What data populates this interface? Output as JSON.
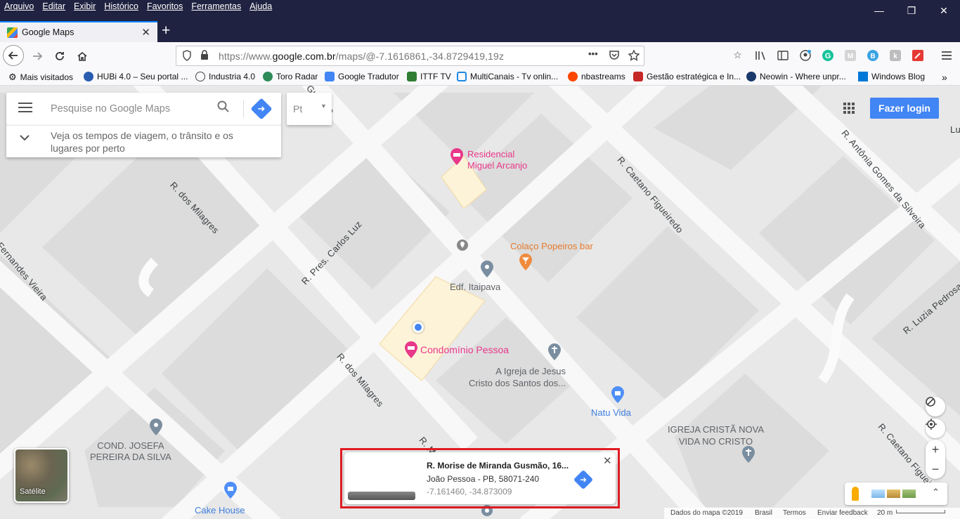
{
  "menubar": {
    "items": [
      "Arquivo",
      "Editar",
      "Exibir",
      "Histórico",
      "Favoritos",
      "Ferramentas",
      "Ajuda"
    ],
    "minimize": "—",
    "restore": "❐",
    "close": "✕"
  },
  "tab": {
    "title": "Google Maps",
    "close": "✕",
    "new_tab": "+"
  },
  "nav": {
    "url_prefix": "https://www.",
    "url_domain": "google.com.br",
    "url_rest": "/maps/@-7.1616861,-34.8729419,19z",
    "more": "•••"
  },
  "bookmarks": [
    {
      "label": "Mais visitados",
      "color": "#555555"
    },
    {
      "label": "HUBi 4.0 – Seu portal ...",
      "color": "#2a5db0"
    },
    {
      "label": "Industria 4.0",
      "color": "#444444"
    },
    {
      "label": "Toro Radar",
      "color": "#2e8b57"
    },
    {
      "label": "Google Tradutor",
      "color": "#4285f4"
    },
    {
      "label": "ITTF TV",
      "color": "#2f7d32"
    },
    {
      "label": "MultiCanais - Tv onlin...",
      "color": "#1e88e5"
    },
    {
      "label": "nbastreams",
      "color": "#ff4500"
    },
    {
      "label": "Gestão estratégica e In...",
      "color": "#c62828"
    },
    {
      "label": "Neowin - Where unpr...",
      "color": "#1a3a6b"
    },
    {
      "label": "Windows Blog",
      "color": "#0078d7"
    }
  ],
  "search": {
    "placeholder": "Pesquise no Google Maps",
    "traffic_text": "Veja os tempos de viagem, o trânsito e os lugares por perto",
    "layer_label": "Pt"
  },
  "login_label": "Fazer login",
  "map": {
    "streets": [
      "R. Morise de Miranda Gusmão",
      "R. dos Milagres",
      "R. Pres. Carlos Luz",
      "R. Caetano Figueiredo",
      "R. Antônia Gomes da Silveira",
      "R. Luzia Pedrosa",
      "R. dos Milagres",
      "Fernandes Vieira",
      "R. Caetano Figueiredo",
      "R. M...",
      "Lu"
    ],
    "pois": {
      "residencial": "Residencial\nMiguel Arcanjo",
      "bar": "Colaço Popeiros bar",
      "itaipava": "Edf. Itaipava",
      "condominio": "Condomínio Pessoa",
      "igreja": "A Igreja de Jesus\nCristo dos Santos dos...",
      "natu": "Natu Vida",
      "igreja_crista": "IGREJA CRISTÃ NOVA\nVIDA NO CRISTO",
      "josefa": "COND. JOSEFA\nPEREIRA DA SILVA",
      "cake": "Cake House"
    }
  },
  "satellite_label": "Satélite",
  "card": {
    "title": "R. Morise de Miranda Gusmão, 16...",
    "address": "João Pessoa - PB, 58071-240",
    "coords": "-7.161460, -34.873009",
    "close": "✕"
  },
  "footer": {
    "map_data": "Dados do mapa ©2019",
    "country": "Brasil",
    "terms": "Termos",
    "feedback": "Enviar feedback",
    "scale": "20 m"
  },
  "colors": {
    "accent": "#4285f4",
    "highlight_frame": "#e01b22",
    "titlebar": "#1f2240"
  }
}
